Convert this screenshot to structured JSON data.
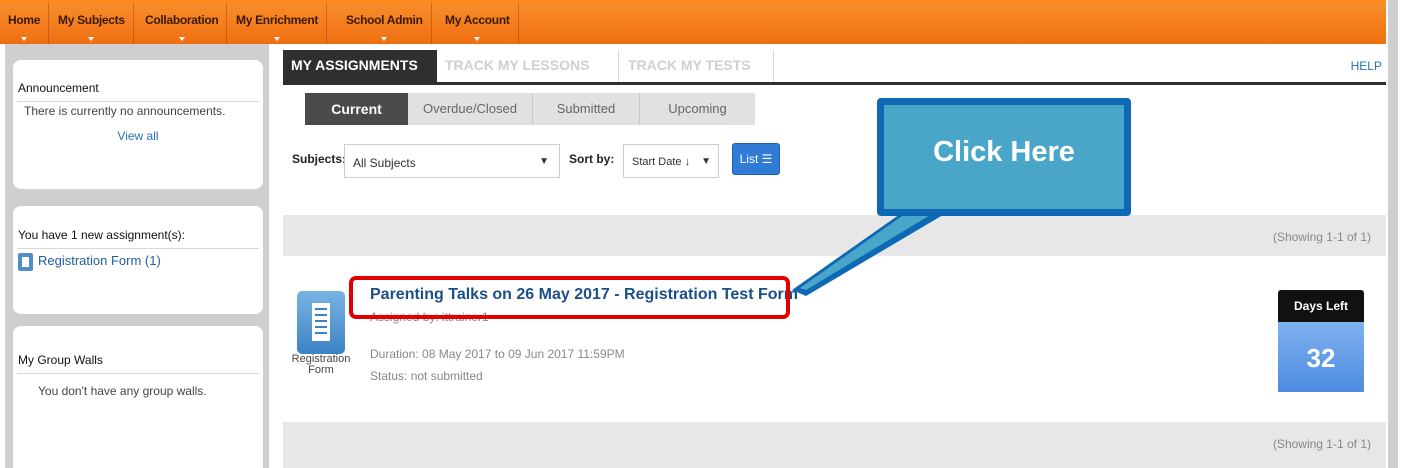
{
  "topnav": {
    "items": [
      "Home",
      "My Subjects",
      "Collaboration",
      "My Enrichment",
      "School Admin",
      "My Account"
    ]
  },
  "sidebar": {
    "announcement": {
      "title": "Announcement",
      "text": "There is currently no announcements.",
      "view_all": "View all"
    },
    "new_assignments": {
      "title": "You have 1 new assignment(s):",
      "link": "Registration Form (1)"
    },
    "group_walls": {
      "title": "My Group Walls",
      "text": "You don't have any group walls."
    }
  },
  "main_tabs": {
    "assignments": "MY ASSIGNMENTS",
    "lessons": "TRACK MY LESSONS",
    "tests": "TRACK MY TESTS",
    "help": "HELP"
  },
  "sub_tabs": [
    "Current",
    "Overdue/Closed",
    "Submitted",
    "Upcoming"
  ],
  "filters": {
    "subjects_label": "Subjects:",
    "subjects_value": "All Subjects",
    "sort_label": "Sort by:",
    "sort_value": "Start Date ↓",
    "list_button": "List ☰"
  },
  "showing_top": "(Showing 1-1 of 1)",
  "showing_bottom": "(Showing 1-1 of 1)",
  "assignment": {
    "icon_caption": "Registration Form",
    "title": "Parenting Talks on 26 May 2017 - Registration Test Form",
    "assigned_by": "Assigned by: ittrainer1",
    "duration": "Duration: 08 May 2017 to 09 Jun 2017 11:59PM",
    "status": "Status: not submitted",
    "days_left_label": "Days Left",
    "days_left": "32"
  },
  "callout": {
    "text": "Click Here",
    "fill_color": "#4aa6c8",
    "border_color": "#0d69b4"
  },
  "colors": {
    "nav_orange": "#f98d2b",
    "highlight_red": "#e00000",
    "link_blue": "#1b4f8a"
  }
}
